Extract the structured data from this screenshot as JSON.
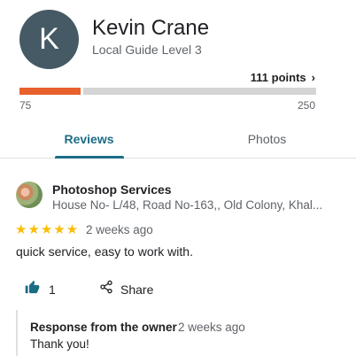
{
  "profile": {
    "avatar_letter": "K",
    "name": "Kevin Crane",
    "level": "Local Guide Level 3",
    "points_link": "111 points",
    "points_chevron": "›",
    "progress": {
      "value": 111,
      "min_label": "75",
      "max_label": "250",
      "min": 75,
      "max": 250
    }
  },
  "tabs": [
    {
      "label": "Reviews",
      "active": true
    },
    {
      "label": "Photos",
      "active": false
    }
  ],
  "review": {
    "place_name": "Photoshop Services",
    "place_address": "House No- L/48, Road No-163,, Old Colony, Khal...",
    "rating": 5,
    "stars": "★★★★★",
    "time": "2 weeks ago",
    "text": "quick service, easy to work with.",
    "likes": "1",
    "share_label": "Share"
  },
  "owner_response": {
    "title": "Response from the owner",
    "time": "2 weeks ago",
    "text": "Thank you!"
  },
  "colors": {
    "accent_tab": "#1b6d85",
    "progress_fill": "#e8602c",
    "progress_track": "#d4d4d4",
    "star": "#fbbc04",
    "avatar_bg": "#455a64"
  },
  "icons": {
    "like": "thumbs-up-icon",
    "share": "share-icon",
    "chevron": "chevron-right-icon"
  }
}
